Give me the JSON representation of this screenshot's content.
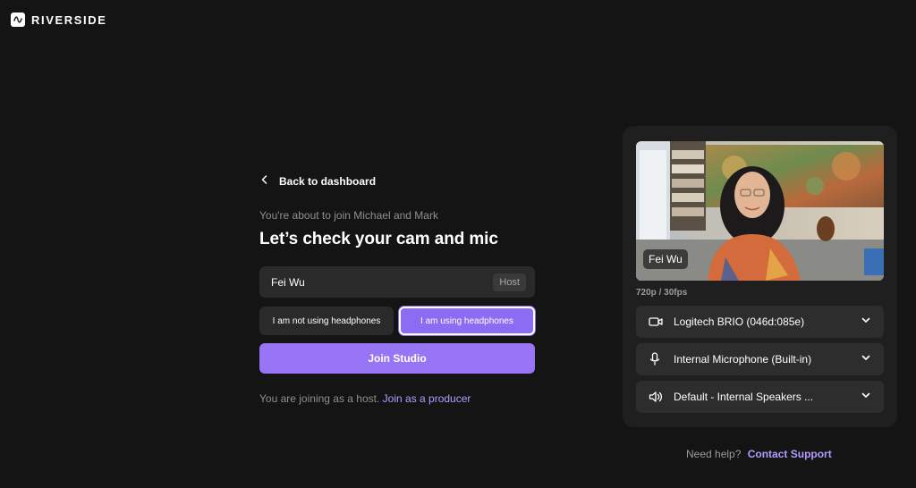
{
  "brand": {
    "name": "RIVERSIDE"
  },
  "back": {
    "label": "Back to dashboard"
  },
  "intro": {
    "subtitle": "You're about to join Michael and Mark",
    "headline": "Let’s check your cam and mic"
  },
  "name_field": {
    "value": "Fei Wu",
    "role_tag": "Host"
  },
  "headphones": {
    "no_label": "I am not using headphones",
    "yes_label": "I am using headphones",
    "selected": "yes"
  },
  "join_button": {
    "label": "Join Studio"
  },
  "joining": {
    "text": "You are joining as a host.",
    "link": "Join as a producer"
  },
  "preview": {
    "participant_name": "Fei Wu",
    "resolution": "720p / 30fps"
  },
  "devices": {
    "camera": {
      "label": "Logitech BRIO (046d:085e)",
      "icon": "camera-icon"
    },
    "microphone": {
      "label": "Internal Microphone (Built-in)",
      "icon": "microphone-icon"
    },
    "speaker": {
      "label": "Default - Internal Speakers ...",
      "icon": "speaker-icon"
    }
  },
  "help": {
    "text": "Need help?",
    "link": "Contact Support"
  },
  "colors": {
    "background": "#141414",
    "accent": "#9775f5",
    "link": "#b39cff",
    "panel": "#1f1f1f"
  }
}
